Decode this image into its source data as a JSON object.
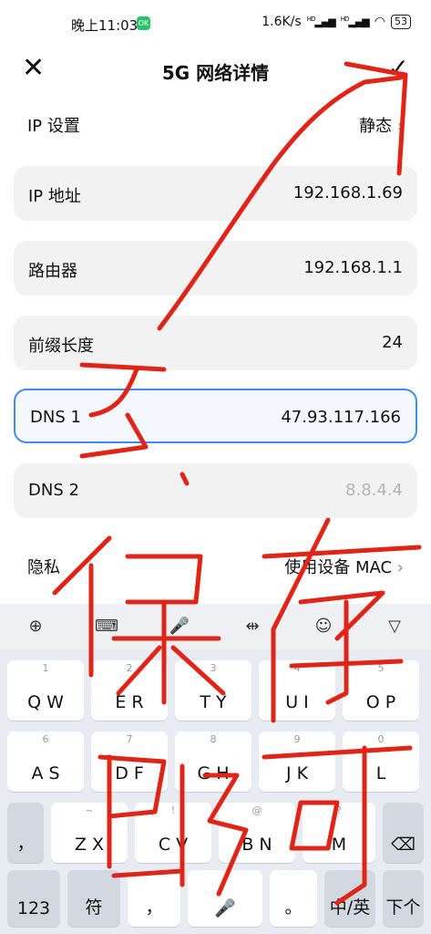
{
  "status_bar": {
    "time": "晚上11:03",
    "app_badge": "OK",
    "net_speed": "1.6K/s",
    "hd1": "HD",
    "hd2": "HD",
    "battery": "53"
  },
  "header": {
    "title": "5G 网络详情"
  },
  "settings": {
    "ip_settings_label": "IP 设置",
    "ip_settings_value": "静态",
    "ip_address_label": "IP 地址",
    "ip_address_value": "192.168.1.69",
    "router_label": "路由器",
    "router_value": "192.168.1.1",
    "prefix_label": "前缀长度",
    "prefix_value": "24",
    "dns1_label": "DNS 1",
    "dns1_value": "47.93.117.166",
    "dns2_label": "DNS 2",
    "dns2_placeholder": "8.8.4.4",
    "privacy_label": "隐私",
    "privacy_value": "使用设备 MAC"
  },
  "keyboard": {
    "toolbar_icons": [
      "ifly-icon",
      "keyboard-icon",
      "microphone-icon",
      "cursor-icon",
      "emoji-icon",
      "hide-keyboard-icon"
    ],
    "rows": [
      [
        {
          "hint": "1",
          "main": "Q W"
        },
        {
          "hint": "2",
          "main": "E R"
        },
        {
          "hint": "3",
          "main": "T Y"
        },
        {
          "hint": "4",
          "main": "U I"
        },
        {
          "hint": "5",
          "main": "O P"
        }
      ],
      [
        {
          "hint": "6",
          "main": "A S"
        },
        {
          "hint": "7",
          "main": "D F"
        },
        {
          "hint": "8",
          "main": "G H"
        },
        {
          "hint": "9",
          "main": "J K"
        },
        {
          "hint": "0",
          "main": "L"
        }
      ],
      [
        {
          "hint": "",
          "main": "，"
        },
        {
          "hint": "~",
          "main": "Z X"
        },
        {
          "hint": "!",
          "main": "C V"
        },
        {
          "hint": "@",
          "main": "B N"
        },
        {
          "hint": "?",
          "main": "M"
        },
        {
          "hint": "",
          "main": "⌫"
        }
      ],
      [
        {
          "hint": "",
          "main": "123"
        },
        {
          "hint": "",
          "main": "符"
        },
        {
          "hint": "",
          "main": "，"
        },
        {
          "hint": "",
          "main": "🎤"
        },
        {
          "hint": "",
          "main": "。"
        },
        {
          "hint": "",
          "main": "中/英"
        },
        {
          "hint": "",
          "main": "下个"
        }
      ]
    ]
  },
  "annotation": {
    "number": "5",
    "text": "保存即可",
    "color": "#e02418"
  }
}
